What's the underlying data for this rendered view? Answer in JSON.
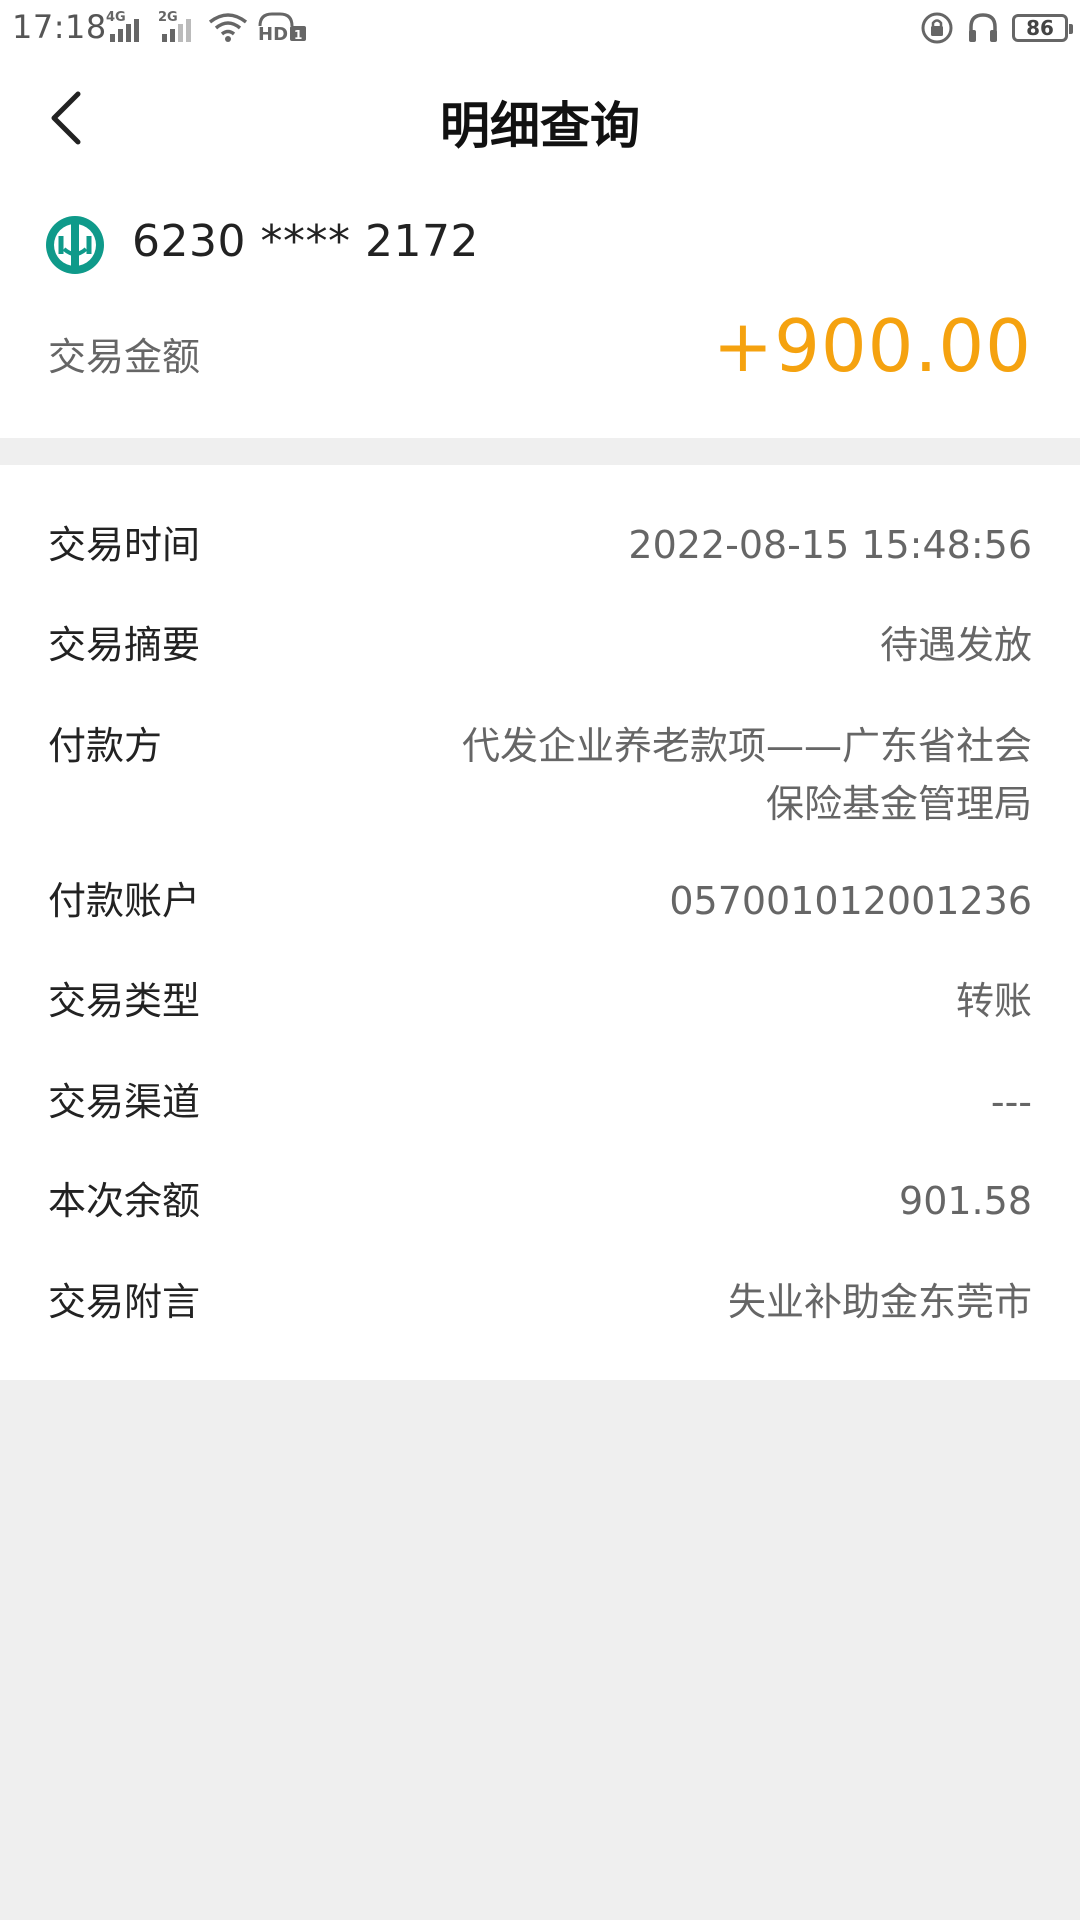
{
  "status_bar": {
    "time": "17:18",
    "network_1": "4G",
    "network_2": "2G",
    "battery": "86"
  },
  "header": {
    "title": "明细查询"
  },
  "summary": {
    "card_number": "6230 **** 2172",
    "amount_label": "交易金额",
    "amount_value": "+900.00",
    "amount_color": "#f5a20f"
  },
  "details": {
    "rows": [
      {
        "label": "交易时间",
        "value": "2022-08-15 15:48:56"
      },
      {
        "label": "交易摘要",
        "value": "待遇发放"
      },
      {
        "label": "付款方",
        "value_lines": [
          "代发企业养老款项——广东省社会",
          "保险基金管理局"
        ]
      },
      {
        "label": "付款账户",
        "value": "057001012001236"
      },
      {
        "label": "交易类型",
        "value": "转账"
      },
      {
        "label": "交易渠道",
        "value": "---"
      },
      {
        "label": "本次余额",
        "value": "901.58"
      },
      {
        "label": "交易附言",
        "value": "失业补助金东莞市"
      }
    ]
  },
  "icons": {
    "back": "chevron-left-icon",
    "bank_logo": "abc-bank-logo",
    "lock": "lock-rotation-icon",
    "headphones": "headphones-icon",
    "wifi": "wifi-icon",
    "hd": "hd-volte-icon"
  }
}
